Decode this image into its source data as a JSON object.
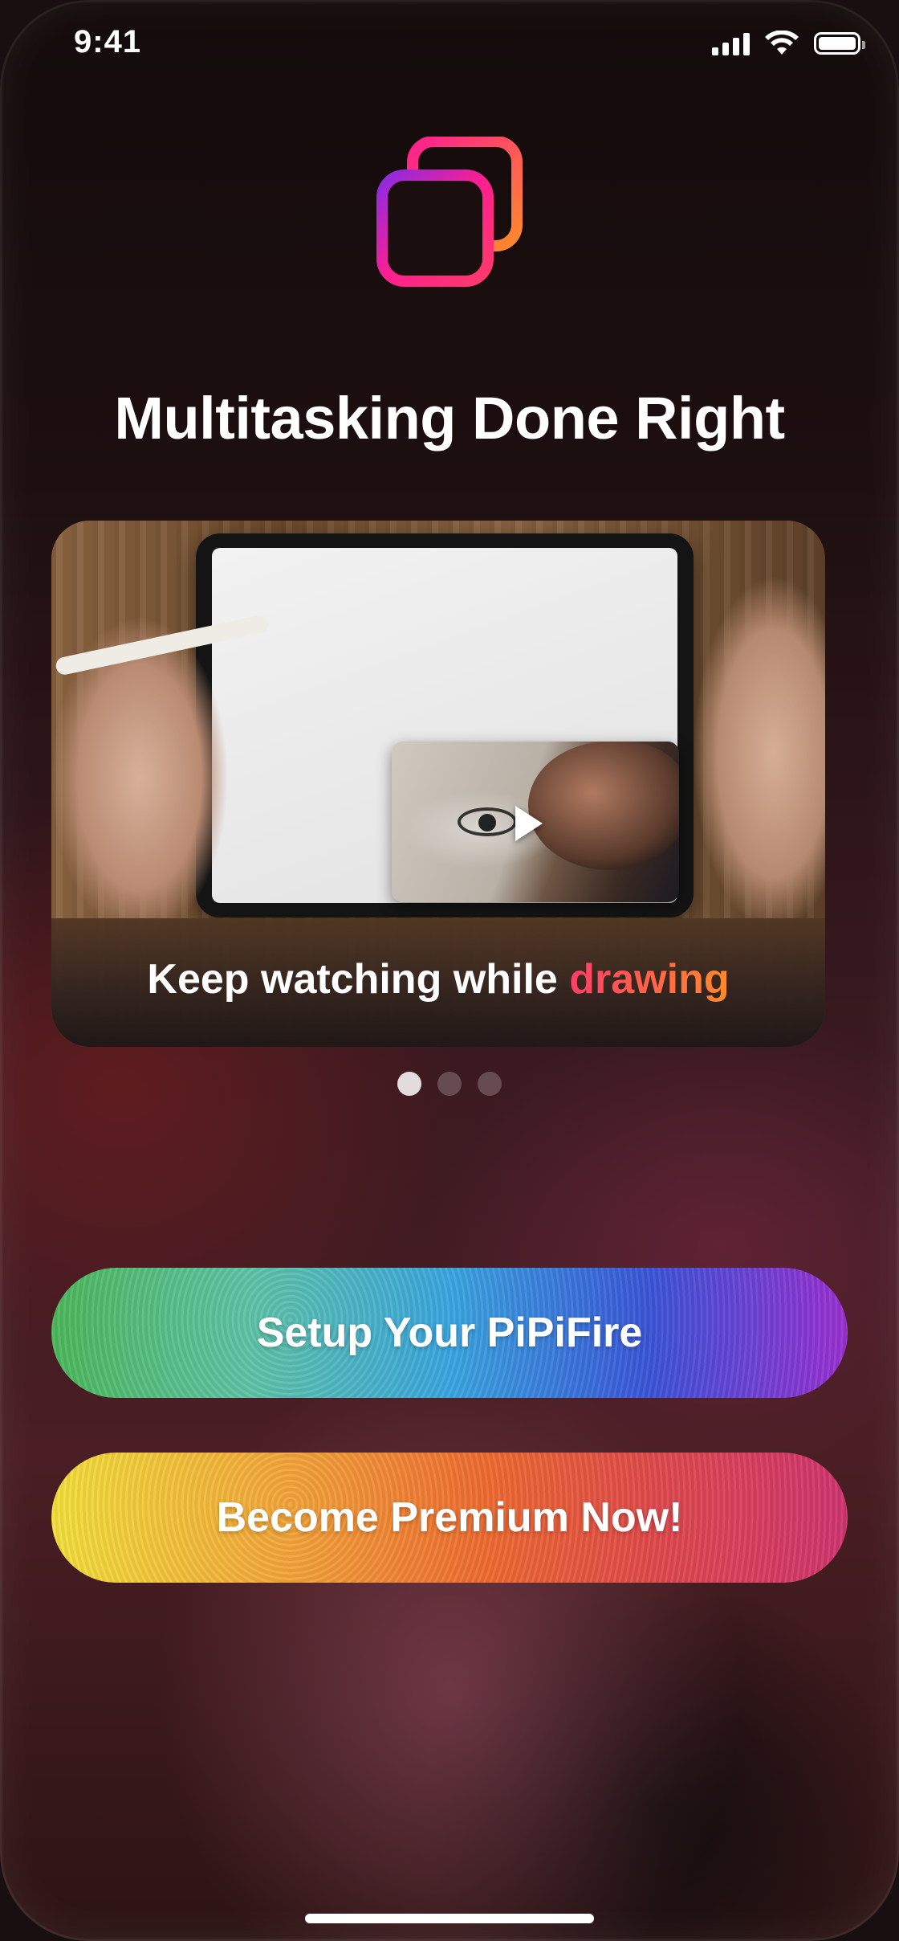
{
  "status_bar": {
    "time": "9:41",
    "icons": [
      "signal-icon",
      "wifi-icon",
      "battery-icon"
    ]
  },
  "app": {
    "logo_icon": "overlapping-squares-icon",
    "headline": "Multitasking Done Right"
  },
  "carousel": {
    "slides": [
      {
        "caption_prefix": "Keep watching while",
        "caption_highlight": "drawing",
        "media": "ipad-drawing-with-pip-video",
        "play_icon": "play-icon"
      }
    ],
    "page_count": 3,
    "active_index": 0
  },
  "actions": {
    "setup_label": "Setup Your PiPiFire",
    "premium_label": "Become Premium Now!"
  },
  "colors": {
    "setup_gradient": [
      "#4cb85a",
      "#3aa6e0",
      "#9a2fd0"
    ],
    "premium_gradient": [
      "#f2e03c",
      "#ee6a30",
      "#cf3470"
    ],
    "logo_gradient": [
      "#8a2be2",
      "#ff1f8f",
      "#ff8a2a"
    ],
    "caption_accent": [
      "#ff3d6a",
      "#ff8a2a"
    ]
  }
}
